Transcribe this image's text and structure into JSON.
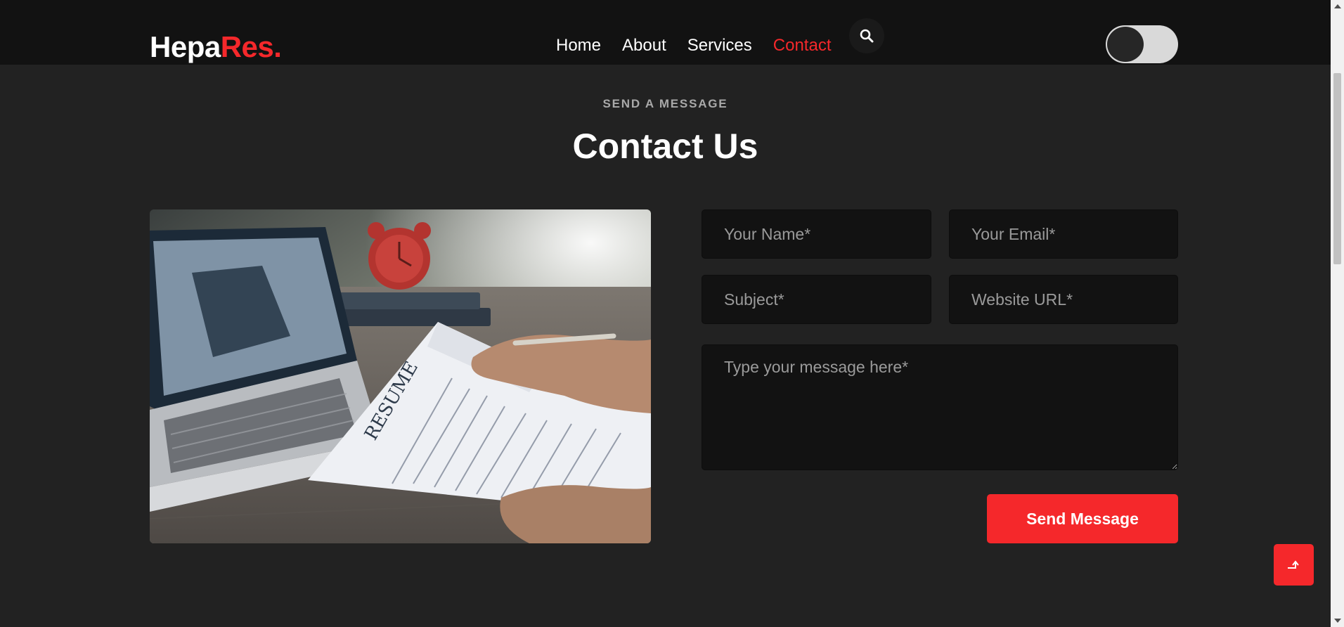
{
  "brand": {
    "name_main": "Hepa",
    "name_accent": "Res."
  },
  "nav": {
    "items": [
      {
        "label": "Home"
      },
      {
        "label": "About"
      },
      {
        "label": "Services"
      },
      {
        "label": "Contact",
        "active": true
      }
    ]
  },
  "header_icons": {
    "search": "search-icon",
    "theme_toggle": "dark-mode-toggle"
  },
  "section": {
    "eyebrow": "SEND A MESSAGE",
    "title": "Contact Us"
  },
  "form": {
    "name_placeholder": "Your Name*",
    "email_placeholder": "Your Email*",
    "subject_placeholder": "Subject*",
    "website_placeholder": "Website URL*",
    "message_placeholder": "Type your message here*",
    "submit_label": "Send Message"
  },
  "colors": {
    "accent": "#f5282b",
    "background": "#222222",
    "header": "#121212",
    "field": "#121212"
  }
}
